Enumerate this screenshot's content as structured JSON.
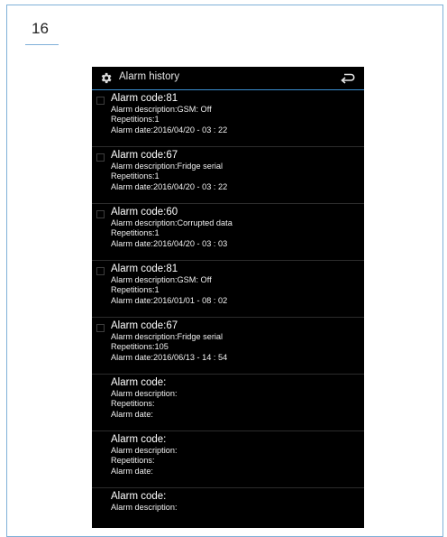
{
  "page": {
    "number": "16"
  },
  "header": {
    "title": "Alarm history",
    "settings_icon": "gear-icon",
    "back_icon": "back-arrow-icon"
  },
  "alarms": [
    {
      "code": "Alarm code:81",
      "description": "Alarm description:GSM: Off",
      "repetitions": "Repetitions:1",
      "date": "Alarm date:2016/04/20 - 03 : 22",
      "checkbox": true
    },
    {
      "code": "Alarm code:67",
      "description": "Alarm description:Fridge serial",
      "repetitions": "Repetitions:1",
      "date": "Alarm date:2016/04/20 - 03 : 22",
      "checkbox": true
    },
    {
      "code": "Alarm code:60",
      "description": "Alarm description:Corrupted data",
      "repetitions": "Repetitions:1",
      "date": "Alarm date:2016/04/20 - 03 : 03",
      "checkbox": true
    },
    {
      "code": "Alarm code:81",
      "description": "Alarm description:GSM: Off",
      "repetitions": "Repetitions:1",
      "date": "Alarm date:2016/01/01 - 08 : 02",
      "checkbox": true
    },
    {
      "code": "Alarm code:67",
      "description": "Alarm description:Fridge serial",
      "repetitions": "Repetitions:105",
      "date": "Alarm date:2016/06/13 - 14 : 54",
      "checkbox": true
    },
    {
      "code": "Alarm code:",
      "description": "Alarm description:",
      "repetitions": "Repetitions:",
      "date": "Alarm date:",
      "checkbox": false
    },
    {
      "code": "Alarm code:",
      "description": "Alarm description:",
      "repetitions": "Repetitions:",
      "date": "Alarm date:",
      "checkbox": false
    },
    {
      "code": "Alarm code:",
      "description": "Alarm description:",
      "repetitions": "",
      "date": "",
      "checkbox": false
    }
  ],
  "colors": {
    "accent": "#3a8fd0",
    "frame": "#7fb0d8",
    "screen_bg": "#000000"
  }
}
